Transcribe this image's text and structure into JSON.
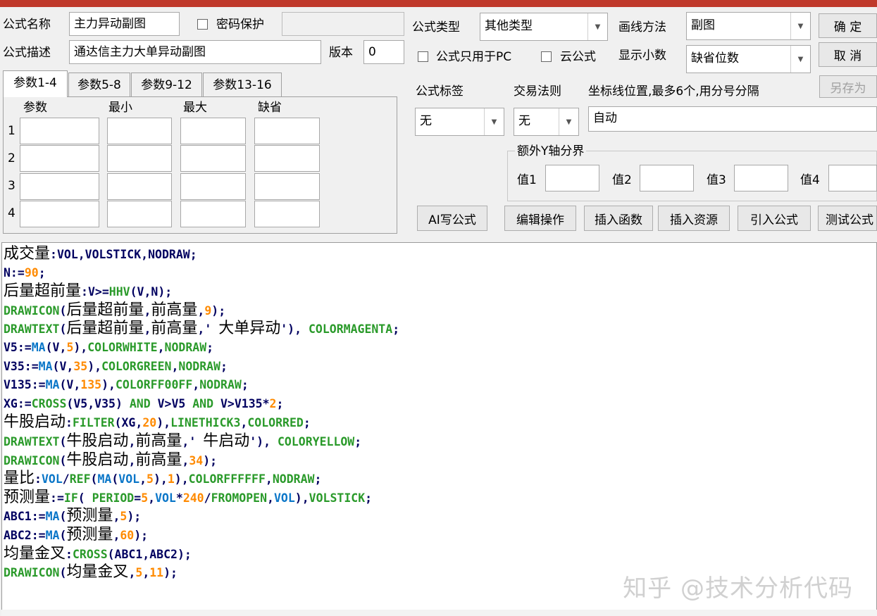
{
  "form": {
    "name_label": "公式名称",
    "name_value": "主力异动副图",
    "password_label": "密码保护",
    "password_checked": false,
    "password_value": "",
    "desc_label": "公式描述",
    "desc_value": "通达信主力大单异动副图",
    "version_label": "版本",
    "version_value": "0"
  },
  "right": {
    "type_label": "公式类型",
    "type_value": "其他类型",
    "draw_label": "画线方法",
    "draw_value": "副图",
    "pc_only_label": "公式只用于PC",
    "cloud_label": "云公式",
    "decimals_label": "显示小数",
    "decimals_value": "缺省位数",
    "tag_label": "公式标签",
    "tag_value": "无",
    "rule_label": "交易法则",
    "rule_value": "无",
    "axis_label": "坐标线位置,最多6个,用分号分隔",
    "axis_value": "自动",
    "extra_y_label": "额外Y轴分界",
    "v1": "值1",
    "v2": "值2",
    "v3": "值3",
    "v4": "值4"
  },
  "buttons": {
    "ok": "确 定",
    "cancel": "取 消",
    "save_as": "另存为",
    "ai": "AI写公式",
    "edit": "编辑操作",
    "insert_func": "插入函数",
    "insert_res": "插入资源",
    "import": "引入公式",
    "test": "测试公式"
  },
  "tabs": [
    "参数1-4",
    "参数5-8",
    "参数9-12",
    "参数13-16"
  ],
  "params": {
    "headers": [
      "参数",
      "最小",
      "最大",
      "缺省"
    ],
    "rows": [
      "1",
      "2",
      "3",
      "4"
    ]
  },
  "code_lines": [
    [
      [
        "成交量",
        "zh",
        "c-black"
      ],
      [
        ":VOL,VOLSTICK,NODRAW;",
        "mono",
        "c-navy"
      ]
    ],
    [
      [
        "N:=",
        "mono",
        "c-navy"
      ],
      [
        "90",
        "mono",
        "c-orange"
      ],
      [
        ";",
        "mono",
        "c-navy"
      ]
    ],
    [
      [
        "后量超前量",
        "zh",
        "c-black"
      ],
      [
        ":V>=",
        "mono",
        "c-navy"
      ],
      [
        "HHV",
        "mono",
        "c-green"
      ],
      [
        "(V,N);",
        "mono",
        "c-navy"
      ]
    ],
    [
      [
        "DRAWICON",
        "mono",
        "c-green"
      ],
      [
        "(",
        "mono",
        "c-navy"
      ],
      [
        "后量超前量",
        "zh",
        "c-black"
      ],
      [
        ",",
        "mono",
        "c-navy"
      ],
      [
        "前高量",
        "zh",
        "c-black"
      ],
      [
        ",",
        "mono",
        "c-navy"
      ],
      [
        "9",
        "mono",
        "c-orange"
      ],
      [
        ");",
        "mono",
        "c-navy"
      ]
    ],
    [
      [
        "DRAWTEXT",
        "mono",
        "c-green"
      ],
      [
        "(",
        "mono",
        "c-navy"
      ],
      [
        "后量超前量",
        "zh",
        "c-black"
      ],
      [
        ",",
        "mono",
        "c-navy"
      ],
      [
        "前高量",
        "zh",
        "c-black"
      ],
      [
        ",' ",
        "mono",
        "c-navy"
      ],
      [
        "大单异动",
        "zh",
        "c-black"
      ],
      [
        "'), ",
        "mono",
        "c-navy"
      ],
      [
        "COLORMAGENTA",
        "mono",
        "c-green"
      ],
      [
        ";",
        "mono",
        "c-navy"
      ]
    ],
    [
      [
        "V5:=",
        "mono",
        "c-navy"
      ],
      [
        "MA",
        "mono",
        "c-blue"
      ],
      [
        "(V,",
        "mono",
        "c-navy"
      ],
      [
        "5",
        "mono",
        "c-orange"
      ],
      [
        "),",
        "mono",
        "c-navy"
      ],
      [
        "COLORWHITE",
        "mono",
        "c-green"
      ],
      [
        ",",
        "mono",
        "c-navy"
      ],
      [
        "NODRAW",
        "mono",
        "c-green"
      ],
      [
        ";",
        "mono",
        "c-navy"
      ]
    ],
    [
      [
        "V35:=",
        "mono",
        "c-navy"
      ],
      [
        "MA",
        "mono",
        "c-blue"
      ],
      [
        "(V,",
        "mono",
        "c-navy"
      ],
      [
        "35",
        "mono",
        "c-orange"
      ],
      [
        "),",
        "mono",
        "c-navy"
      ],
      [
        "COLORGREEN",
        "mono",
        "c-green"
      ],
      [
        ",",
        "mono",
        "c-navy"
      ],
      [
        "NODRAW",
        "mono",
        "c-green"
      ],
      [
        ";",
        "mono",
        "c-navy"
      ]
    ],
    [
      [
        "V135:=",
        "mono",
        "c-navy"
      ],
      [
        "MA",
        "mono",
        "c-blue"
      ],
      [
        "(V,",
        "mono",
        "c-navy"
      ],
      [
        "135",
        "mono",
        "c-orange"
      ],
      [
        "),",
        "mono",
        "c-navy"
      ],
      [
        "COLORFF00FF",
        "mono",
        "c-green"
      ],
      [
        ",",
        "mono",
        "c-navy"
      ],
      [
        "NODRAW",
        "mono",
        "c-green"
      ],
      [
        ";",
        "mono",
        "c-navy"
      ]
    ],
    [
      [
        "XG:=",
        "mono",
        "c-navy"
      ],
      [
        "CROSS",
        "mono",
        "c-green"
      ],
      [
        "(V5,V35) ",
        "mono",
        "c-navy"
      ],
      [
        "AND",
        "mono",
        "c-green"
      ],
      [
        " V>V5 ",
        "mono",
        "c-navy"
      ],
      [
        "AND",
        "mono",
        "c-green"
      ],
      [
        " V>V135*",
        "mono",
        "c-navy"
      ],
      [
        "2",
        "mono",
        "c-orange"
      ],
      [
        ";",
        "mono",
        "c-navy"
      ]
    ],
    [
      [
        "牛股启动",
        "zh",
        "c-black"
      ],
      [
        ":",
        "mono",
        "c-navy"
      ],
      [
        "FILTER",
        "mono",
        "c-green"
      ],
      [
        "(XG,",
        "mono",
        "c-navy"
      ],
      [
        "20",
        "mono",
        "c-orange"
      ],
      [
        "),",
        "mono",
        "c-navy"
      ],
      [
        "LINETHICK3",
        "mono",
        "c-green"
      ],
      [
        ",",
        "mono",
        "c-navy"
      ],
      [
        "COLORRED",
        "mono",
        "c-green"
      ],
      [
        ";",
        "mono",
        "c-navy"
      ]
    ],
    [
      [
        "DRAWTEXT",
        "mono",
        "c-green"
      ],
      [
        "(",
        "mono",
        "c-navy"
      ],
      [
        "牛股启动",
        "zh",
        "c-black"
      ],
      [
        ",",
        "mono",
        "c-navy"
      ],
      [
        "前高量",
        "zh",
        "c-black"
      ],
      [
        ",' ",
        "mono",
        "c-navy"
      ],
      [
        "牛启动",
        "zh",
        "c-black"
      ],
      [
        "'), ",
        "mono",
        "c-navy"
      ],
      [
        "COLORYELLOW",
        "mono",
        "c-green"
      ],
      [
        ";",
        "mono",
        "c-navy"
      ]
    ],
    [
      [
        "DRAWICON",
        "mono",
        "c-green"
      ],
      [
        "(",
        "mono",
        "c-navy"
      ],
      [
        "牛股启动",
        "zh",
        "c-black"
      ],
      [
        ",",
        "mono",
        "c-navy"
      ],
      [
        "前高量",
        "zh",
        "c-black"
      ],
      [
        ",",
        "mono",
        "c-navy"
      ],
      [
        "34",
        "mono",
        "c-orange"
      ],
      [
        ");",
        "mono",
        "c-navy"
      ]
    ],
    [
      [
        "量比",
        "zh",
        "c-black"
      ],
      [
        ":",
        "mono",
        "c-navy"
      ],
      [
        "VOL",
        "mono",
        "c-blue"
      ],
      [
        "/",
        "mono",
        "c-navy"
      ],
      [
        "REF",
        "mono",
        "c-green"
      ],
      [
        "(",
        "mono",
        "c-navy"
      ],
      [
        "MA",
        "mono",
        "c-blue"
      ],
      [
        "(",
        "mono",
        "c-navy"
      ],
      [
        "VOL",
        "mono",
        "c-blue"
      ],
      [
        ",",
        "mono",
        "c-navy"
      ],
      [
        "5",
        "mono",
        "c-orange"
      ],
      [
        "),",
        "mono",
        "c-navy"
      ],
      [
        "1",
        "mono",
        "c-orange"
      ],
      [
        "),",
        "mono",
        "c-navy"
      ],
      [
        "COLORFFFFFF",
        "mono",
        "c-green"
      ],
      [
        ",",
        "mono",
        "c-navy"
      ],
      [
        "NODRAW",
        "mono",
        "c-green"
      ],
      [
        ";",
        "mono",
        "c-navy"
      ]
    ],
    [
      [
        "预测量",
        "zh",
        "c-black"
      ],
      [
        ":=",
        "mono",
        "c-navy"
      ],
      [
        "IF",
        "mono",
        "c-green"
      ],
      [
        "( ",
        "mono",
        "c-navy"
      ],
      [
        "PERIOD",
        "mono",
        "c-green"
      ],
      [
        "=",
        "mono",
        "c-navy"
      ],
      [
        "5",
        "mono",
        "c-orange"
      ],
      [
        ",",
        "mono",
        "c-navy"
      ],
      [
        "VOL",
        "mono",
        "c-blue"
      ],
      [
        "*",
        "mono",
        "c-navy"
      ],
      [
        "240",
        "mono",
        "c-orange"
      ],
      [
        "/",
        "mono",
        "c-navy"
      ],
      [
        "FROMOPEN",
        "mono",
        "c-green"
      ],
      [
        ",",
        "mono",
        "c-navy"
      ],
      [
        "VOL",
        "mono",
        "c-blue"
      ],
      [
        "),",
        "mono",
        "c-navy"
      ],
      [
        "VOLSTICK",
        "mono",
        "c-green"
      ],
      [
        ";",
        "mono",
        "c-navy"
      ]
    ],
    [
      [
        "ABC1:=",
        "mono",
        "c-navy"
      ],
      [
        "MA",
        "mono",
        "c-blue"
      ],
      [
        "(",
        "mono",
        "c-navy"
      ],
      [
        "预测量",
        "zh",
        "c-black"
      ],
      [
        ",",
        "mono",
        "c-navy"
      ],
      [
        "5",
        "mono",
        "c-orange"
      ],
      [
        ");",
        "mono",
        "c-navy"
      ]
    ],
    [
      [
        "ABC2:=",
        "mono",
        "c-navy"
      ],
      [
        "MA",
        "mono",
        "c-blue"
      ],
      [
        "(",
        "mono",
        "c-navy"
      ],
      [
        "预测量",
        "zh",
        "c-black"
      ],
      [
        ",",
        "mono",
        "c-navy"
      ],
      [
        "60",
        "mono",
        "c-orange"
      ],
      [
        ");",
        "mono",
        "c-navy"
      ]
    ],
    [
      [
        "均量金叉",
        "zh",
        "c-black"
      ],
      [
        ":",
        "mono",
        "c-navy"
      ],
      [
        "CROSS",
        "mono",
        "c-green"
      ],
      [
        "(ABC1,ABC2);",
        "mono",
        "c-navy"
      ]
    ],
    [
      [
        "DRAWICON",
        "mono",
        "c-green"
      ],
      [
        "(",
        "mono",
        "c-navy"
      ],
      [
        "均量金叉",
        "zh",
        "c-black"
      ],
      [
        ",",
        "mono",
        "c-navy"
      ],
      [
        "5",
        "mono",
        "c-orange"
      ],
      [
        ",",
        "mono",
        "c-navy"
      ],
      [
        "11",
        "mono",
        "c-orange"
      ],
      [
        ");",
        "mono",
        "c-navy"
      ]
    ]
  ],
  "watermark": "知乎 @技术分析代码"
}
